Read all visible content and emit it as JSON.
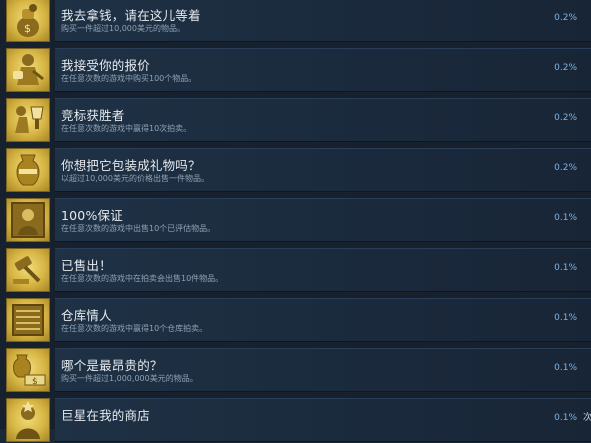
{
  "achievements": [
    {
      "title": "我去拿钱，请在这儿等着",
      "description": "购买一件超过10,000美元的物品。",
      "percent": "0.2%",
      "icon": "money-bag-icon"
    },
    {
      "title": "我接受你的报价",
      "description": "在任意次数的游戏中购买100个物品。",
      "percent": "0.2%",
      "icon": "handshake-icon"
    },
    {
      "title": "竞标获胜者",
      "description": "在任意次数的游戏中赢得10次拍卖。",
      "percent": "0.2%",
      "icon": "trophy-figure-icon"
    },
    {
      "title": "你想把它包装成礼物吗？",
      "description": "以超过10,000美元的价格出售一件物品。",
      "percent": "0.2%",
      "icon": "golden-vase-icon"
    },
    {
      "title": "100%保证",
      "description": "在任意次数的游戏中出售10个已评估物品。",
      "percent": "0.1%",
      "icon": "portrait-painting-icon"
    },
    {
      "title": "已售出！",
      "description": "在任意次数的游戏中在拍卖会出售10件物品。",
      "percent": "0.1%",
      "icon": "gavel-icon"
    },
    {
      "title": "仓库情人",
      "description": "在任意次数的游戏中赢得10个仓库拍卖。",
      "percent": "0.1%",
      "icon": "storage-unit-icon"
    },
    {
      "title": "哪个是最昂贵的？",
      "description": "购买一件超过1,000,000美元的物品。",
      "percent": "0.1%",
      "icon": "vase-and-money-icon"
    },
    {
      "title": "巨星在我的商店",
      "description": "",
      "percent": "0.1%",
      "icon": "celebrity-icon"
    }
  ],
  "edge_text": "次"
}
